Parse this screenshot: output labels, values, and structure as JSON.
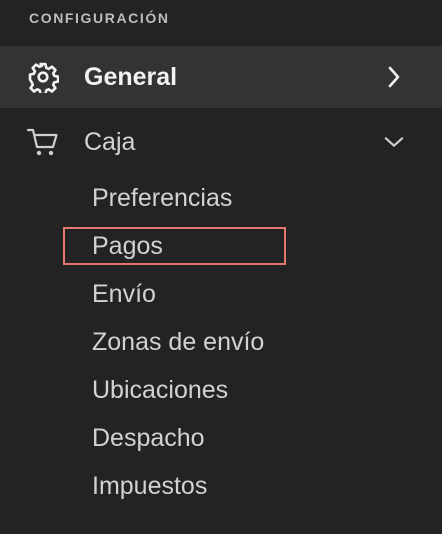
{
  "sidebar": {
    "section_title": "CONFIGURACIÓN",
    "items": [
      {
        "label": "General",
        "icon": "gear-icon",
        "chevron": "chevron-right-icon",
        "active": true
      },
      {
        "label": "Caja",
        "icon": "cart-icon",
        "chevron": "chevron-down-icon",
        "expanded": true
      }
    ],
    "caja_subitems": [
      {
        "label": "Preferencias"
      },
      {
        "label": "Pagos",
        "highlighted": true
      },
      {
        "label": "Envío"
      },
      {
        "label": "Zonas de envío"
      },
      {
        "label": "Ubicaciones"
      },
      {
        "label": "Despacho"
      },
      {
        "label": "Impuestos"
      }
    ]
  },
  "colors": {
    "background": "#232323",
    "active_row": "#333333",
    "highlight_border": "#e4766f"
  }
}
